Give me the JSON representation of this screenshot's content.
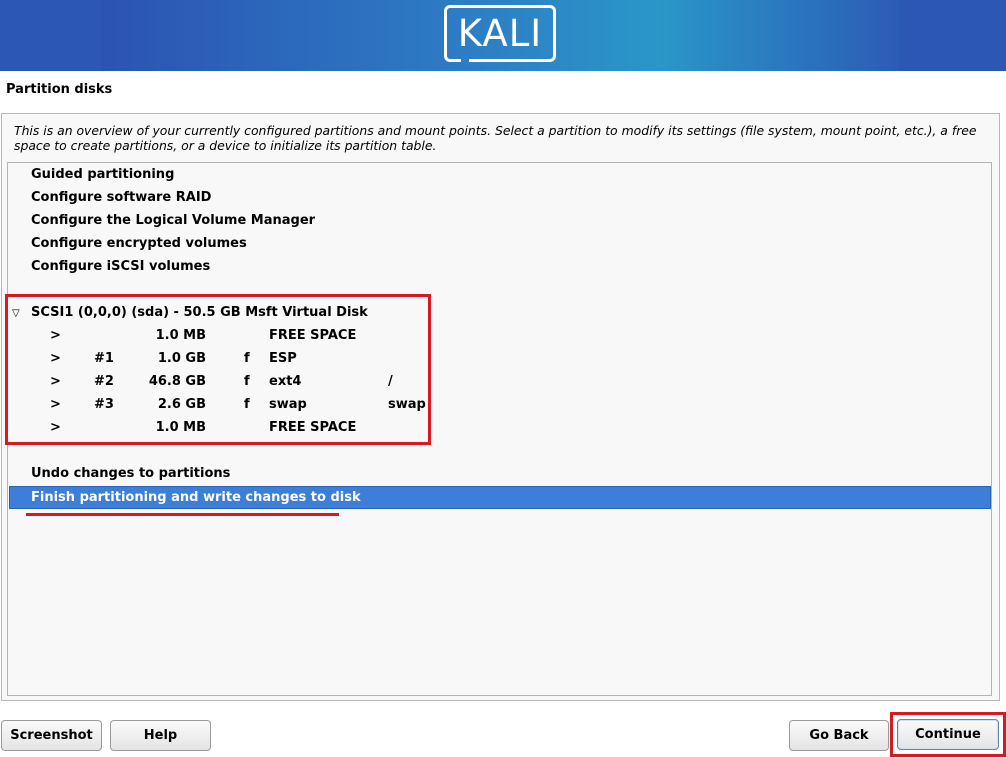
{
  "banner": {
    "logo_text": "KALI"
  },
  "page_title": "Partition disks",
  "description": "This is an overview of your currently configured partitions and mount points. Select a partition to modify its settings (file system, mount point, etc.), a free space to create partitions, or a device to initialize its partition table.",
  "menu_items": [
    "Guided partitioning",
    "Configure software RAID",
    "Configure the Logical Volume Manager",
    "Configure encrypted volumes",
    "Configure iSCSI volumes"
  ],
  "disk": {
    "expander": "▽",
    "label": "SCSI1 (0,0,0) (sda) - 50.5 GB Msft Virtual Disk",
    "partitions": [
      {
        "arrow": ">",
        "num": "",
        "size": "1.0 MB",
        "flag": "",
        "fs": "FREE SPACE",
        "mount": ""
      },
      {
        "arrow": ">",
        "num": "#1",
        "size": "1.0 GB",
        "flag": "f",
        "fs": "ESP",
        "mount": ""
      },
      {
        "arrow": ">",
        "num": "#2",
        "size": "46.8 GB",
        "flag": "f",
        "fs": "ext4",
        "mount": "/"
      },
      {
        "arrow": ">",
        "num": "#3",
        "size": "2.6 GB",
        "flag": "f",
        "fs": "swap",
        "mount": "swap"
      },
      {
        "arrow": ">",
        "num": "",
        "size": "1.0 MB",
        "flag": "",
        "fs": "FREE SPACE",
        "mount": ""
      }
    ]
  },
  "actions": {
    "undo": "Undo changes to partitions",
    "finish": "Finish partitioning and write changes to disk"
  },
  "buttons": {
    "screenshot": "Screenshot",
    "help": "Help",
    "go_back": "Go Back",
    "continue": "Continue"
  },
  "colors": {
    "annotation": "#d71920",
    "selection": "#3d7ed8",
    "banner": "#2d57b5"
  }
}
